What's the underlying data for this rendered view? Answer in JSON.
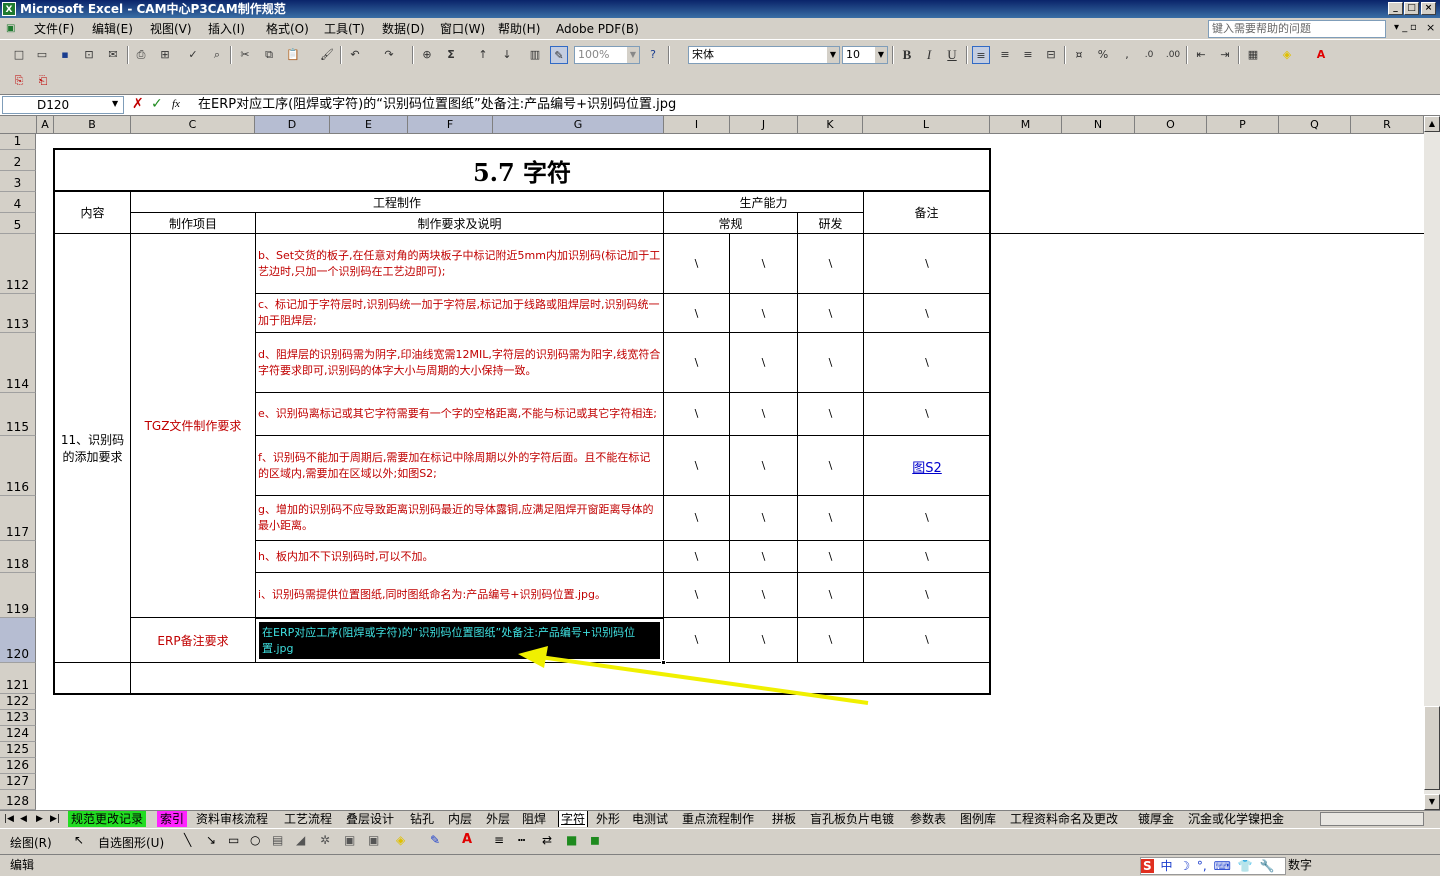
{
  "app": {
    "title": "Microsoft Excel - CAM中心P3CAM制作规范"
  },
  "menu": [
    "文件(F)",
    "编辑(E)",
    "视图(V)",
    "插入(I)",
    "格式(O)",
    "工具(T)",
    "数据(D)",
    "窗口(W)",
    "帮助(H)",
    "Adobe PDF(B)"
  ],
  "help_placeholder": "键入需要帮助的问题",
  "toolbar": {
    "zoom": "100%",
    "font": "宋体",
    "font_size": "10",
    "bold": "B",
    "italic": "I",
    "underline": "U"
  },
  "formula": {
    "cell_ref": "D120",
    "fx": "fx",
    "content": "在ERP对应工序(阻焊或字符)的“识别码位置图纸”处备注:产品编号+识别码位置.jpg"
  },
  "columns": [
    "A",
    "B",
    "C",
    "D",
    "E",
    "F",
    "G",
    "I",
    "J",
    "K",
    "L",
    "M",
    "N",
    "O",
    "P",
    "Q",
    "R"
  ],
  "rows": [
    "1",
    "2",
    "3",
    "4",
    "5",
    "112",
    "113",
    "114",
    "115",
    "116",
    "117",
    "118",
    "119",
    "120",
    "121",
    "122",
    "123",
    "124",
    "125",
    "126",
    "127",
    "128"
  ],
  "sheet": {
    "title": "5.7 字符",
    "hdr_content": "内容",
    "hdr_engineering": "工程制作",
    "hdr_capability": "生产能力",
    "hdr_remark": "备注",
    "hdr_item": "制作项目",
    "hdr_requirement": "制作要求及说明",
    "hdr_regular": "常规",
    "hdr_rnd": "研发",
    "content_label": "11、识别码的添加要求",
    "item_tgz": "TGZ文件制作要求",
    "item_erp": "ERP备注要求",
    "requirements": [
      {
        "text": "b、Set交货的板子,在任意对角的两块板子中标记附近5mm内加识别码(标记加于工艺边时,只加一个识别码在工艺边即可);",
        "regular": "\\",
        "rnd": "\\",
        "other": "\\",
        "remark": "\\"
      },
      {
        "text": "c、标记加于字符层时,识别码统一加于字符层,标记加于线路或阻焊层时,识别码统一加于阻焊层;",
        "regular": "\\",
        "rnd": "\\",
        "other": "\\",
        "remark": "\\"
      },
      {
        "text": "d、阻焊层的识别码需为阴字,印油线宽需12MIL,字符层的识别码需为阳字,线宽符合字符要求即可,识别码的体字大小与周期的大小保持一致。",
        "regular": "\\",
        "rnd": "\\",
        "other": "\\",
        "remark": "\\"
      },
      {
        "text": "e、识别码离标记或其它字符需要有一个字的空格距离,不能与标记或其它字符相连;",
        "regular": "\\",
        "rnd": "\\",
        "other": "\\",
        "remark": "\\"
      },
      {
        "text": "f、识别码不能加于周期后,需要加在标记中除周期以外的字符后面。且不能在标记的区域内,需要加在区域以外;如图S2;",
        "regular": "\\",
        "rnd": "\\",
        "other": "\\",
        "remark": "图S2"
      },
      {
        "text": "g、增加的识别码不应导致距离识别码最近的导体露铜,应满足阻焊开窗距离导体的最小距离。",
        "regular": "\\",
        "rnd": "\\",
        "other": "\\",
        "remark": "\\"
      },
      {
        "text": "h、板内加不下识别码时,可以不加。",
        "regular": "\\",
        "rnd": "\\",
        "other": "\\",
        "remark": "\\"
      },
      {
        "text": "i、识别码需提供位置图纸,同时图纸命名为:产品编号+识别码位置.jpg。",
        "regular": "\\",
        "rnd": "\\",
        "other": "\\",
        "remark": "\\"
      },
      {
        "text": "在ERP对应工序(阻焊或字符)的“识别码位置图纸”处备注:产品编号+识别码位置.jpg",
        "regular": "\\",
        "rnd": "\\",
        "other": "\\",
        "remark": "\\"
      }
    ]
  },
  "tabs": [
    "规范更改记录",
    "索引",
    "资料审核流程",
    "工艺流程",
    "叠层设计",
    "钻孔",
    "内层",
    "外层",
    "阻焊",
    "字符",
    "外形",
    "电测试",
    "重点流程制作",
    "拼板",
    "盲孔板负片电镀",
    "参数表",
    "图例库",
    "工程资料命名及更改",
    "镀厚金",
    "沉金或化学镍把金"
  ],
  "drawing": {
    "draw": "绘图(R)",
    "autoshapes": "自选图形(U)"
  },
  "status": {
    "mode": "编辑",
    "num": "数字"
  },
  "ime": [
    "S",
    "中",
    "☽",
    "°,",
    "⌨",
    "👕",
    "🔧"
  ]
}
